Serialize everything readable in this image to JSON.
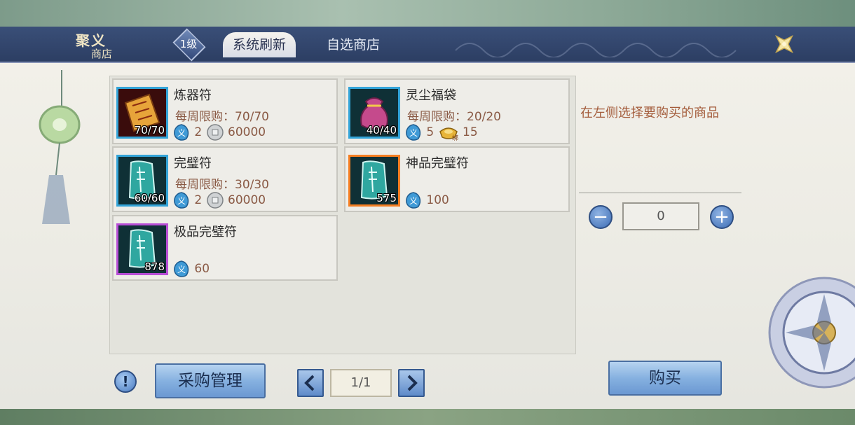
{
  "shop": {
    "title_line1": "聚义",
    "title_line2": "商店",
    "level": "1级",
    "tabs": [
      {
        "label": "系统刷新",
        "active": true
      },
      {
        "label": "自选商店",
        "active": false
      }
    ]
  },
  "items": [
    {
      "name": "炼器符",
      "stock": "70/70",
      "limit_label": "每周限购：70/70",
      "yi_cost": "2",
      "coin_cost": "60000",
      "icon": "refining-talisman-icon",
      "rarity_color": "#33a4d8"
    },
    {
      "name": "灵尘福袋",
      "stock": "40/40",
      "limit_label": "每周限购：20/20",
      "yi_cost": "5",
      "coin_cost": "15",
      "coin_type": "bound-gold-ingot",
      "icon": "lucky-bag-icon",
      "rarity_color": "#33a4d8"
    },
    {
      "name": "完璧符",
      "stock": "60/60",
      "limit_label": "每周限购：30/30",
      "yi_cost": "2",
      "coin_cost": "60000",
      "icon": "scroll-talisman-icon",
      "rarity_color": "#33a4d8"
    },
    {
      "name": "神品完璧符",
      "stock": "575",
      "yi_cost": "100",
      "icon": "scroll-talisman-icon",
      "rarity_color": "#f47e22"
    },
    {
      "name": "极品完璧符",
      "stock": "878",
      "yi_cost": "60",
      "icon": "scroll-talisman-icon",
      "rarity_color": "#b84ed6"
    }
  ],
  "panel": {
    "hint": "在左侧选择要购买的商品",
    "quantity": "0",
    "minus": "−",
    "plus": "+",
    "buy_label": "购买"
  },
  "footer": {
    "info": "!",
    "purchase_manage_label": "采购管理",
    "page": "1/1"
  },
  "colors": {
    "header": "#2c3e63",
    "accent_text": "#8a5a45",
    "hint_text": "#a35b3a",
    "button_blue": "#86b1e0"
  }
}
